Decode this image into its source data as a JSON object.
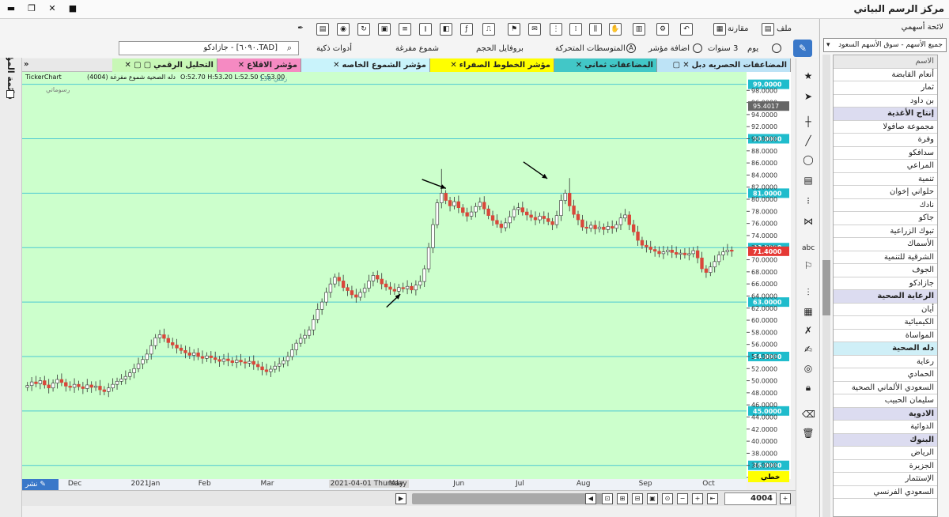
{
  "window": {
    "title": "مركز الرسم البياني"
  },
  "toolbar": {
    "file_label": "ملف",
    "compare_label": "مقارنة",
    "period_day": "يوم",
    "period_years": "3 سنوات",
    "add_indicator": "اضافة مؤشر",
    "moving_averages": "المتوسطات المتحركة",
    "volume_profile": "بروفايل الحجم",
    "hollow_candles": "شموع مفرغة",
    "smart_tools": "أدوات ذكية",
    "symbol_value": "[TAD.٦٠٩٠] - جازادكو"
  },
  "tabs": [
    {
      "label": "المضاعفات الحصريه دبل",
      "color": "#bde3f6"
    },
    {
      "label": "المضاعفات ثماني",
      "color": "#42c7c7"
    },
    {
      "label": "مؤشر الخطوط الصفراء",
      "color": "#ffff00"
    },
    {
      "label": "مؤشر الشموع الخاصه",
      "color": "#c9f3fb"
    },
    {
      "label": "مؤشر الاقلاع",
      "color": "#f58ac2"
    },
    {
      "label": "التحليل الرقمي",
      "color": "#c8f7b6"
    }
  ],
  "chart_header": {
    "source": "TickerChart",
    "description": "(4004) دله الصحية شموع مفرغة",
    "ohlc": "O:52.70  H:53.20  L:52.50  C:53.00",
    "watermark": "رسوماتي",
    "period_tag": "زمني 136"
  },
  "chart_data": {
    "type": "candlestick",
    "ylim": [
      34,
      100
    ],
    "y_ticks": [
      34,
      36,
      38,
      40,
      42,
      44,
      46,
      48,
      50,
      52,
      54,
      56,
      58,
      60,
      62,
      64,
      66,
      68,
      70,
      72,
      74,
      76,
      78,
      80,
      82,
      84,
      86,
      88,
      90,
      92,
      94,
      96,
      98
    ],
    "x_labels": [
      {
        "label": "Dec",
        "pos": 0.085
      },
      {
        "label": "2021Jan",
        "pos": 0.172
      },
      {
        "label": "Feb",
        "pos": 0.265
      },
      {
        "label": "Mar",
        "pos": 0.351
      },
      {
        "label": "2021-04-01 Thursday",
        "pos": 0.445
      },
      {
        "label": "May",
        "pos": 0.528
      },
      {
        "label": "Jun",
        "pos": 0.617
      },
      {
        "label": "Jul",
        "pos": 0.703
      },
      {
        "label": "Aug",
        "pos": 0.787
      },
      {
        "label": "Sep",
        "pos": 0.873
      },
      {
        "label": "Oct",
        "pos": 0.961
      }
    ],
    "horizontal_levels": [
      99,
      90,
      81,
      72,
      63,
      54,
      45,
      36
    ],
    "last_price": 71.4,
    "cursor_price": 95.4017,
    "bottom_label": "خطي",
    "closes": [
      49.2,
      49.8,
      49.5,
      50.0,
      49.3,
      48.8,
      49.6,
      50.2,
      49.7,
      49.1,
      48.9,
      49.4,
      49.0,
      48.7,
      49.3,
      48.9,
      49.1,
      48.5,
      48.2,
      48.8,
      49.4,
      49.9,
      50.3,
      50.7,
      51.3,
      52.0,
      52.8,
      53.5,
      54.4,
      55.8,
      57.1,
      57.6,
      57.0,
      56.3,
      55.9,
      55.4,
      55.0,
      54.6,
      54.2,
      54.6,
      54.0,
      53.7,
      54.1,
      53.8,
      53.5,
      53.2,
      53.6,
      53.3,
      53.0,
      53.4,
      53.1,
      52.9,
      53.2,
      52.7,
      52.3,
      51.8,
      51.5,
      51.9,
      52.4,
      52.8,
      53.3,
      54.0,
      55.1,
      56.2,
      57.0,
      57.5,
      58.4,
      60.1,
      61.8,
      63.0,
      64.6,
      66.0,
      67.1,
      66.5,
      65.4,
      64.9,
      64.2,
      63.8,
      64.6,
      65.3,
      66.5,
      67.4,
      66.8,
      66.0,
      65.5,
      65.1,
      64.8,
      65.4,
      65.2,
      65.6,
      65.0,
      65.8,
      66.4,
      68.5,
      72.0,
      75.8,
      79.4,
      81.0,
      79.8,
      78.9,
      79.6,
      78.6,
      77.8,
      77.2,
      77.9,
      78.8,
      79.5,
      78.4,
      77.3,
      76.5,
      75.9,
      75.3,
      76.1,
      77.1,
      78.3,
      78.6,
      77.9,
      77.4,
      77.0,
      76.6,
      77.2,
      76.8,
      76.3,
      75.8,
      77.3,
      79.8,
      81.0,
      78.9,
      77.5,
      76.6,
      75.4,
      75.2,
      75.7,
      75.1,
      75.4,
      75.0,
      75.5,
      75.2,
      75.8,
      76.9,
      77.4,
      75.8,
      74.6,
      73.2,
      72.4,
      72.1,
      71.7,
      71.4,
      71.0,
      71.3,
      71.6,
      71.2,
      70.9,
      71.1,
      70.8,
      71.0,
      71.5,
      70.3,
      68.5,
      67.9,
      68.8,
      69.7,
      70.8,
      71.3,
      71.6,
      71.4
    ],
    "spike_highs": [
      [
        97,
        85.0
      ],
      [
        127,
        83.5
      ],
      [
        98,
        81.5
      ]
    ],
    "annotations": [
      {
        "type": "arrow",
        "from": [
          0.552,
          0.264
        ],
        "to": [
          0.585,
          0.286
        ]
      },
      {
        "type": "arrow",
        "from": [
          0.692,
          0.221
        ],
        "to": [
          0.725,
          0.262
        ]
      },
      {
        "type": "arrow",
        "from": [
          0.503,
          0.578
        ],
        "to": [
          0.522,
          0.546
        ]
      }
    ]
  },
  "bottom_bar": {
    "zoom_value": "4004",
    "left_label": "نشر"
  },
  "left_panel": {
    "title": "قائمة المؤشرات"
  },
  "right_panel": {
    "title": "لائحة أسهمي",
    "filter": "جميع الأسهم - سوق الأسهم السعود",
    "header": "الاسم",
    "rows": [
      {
        "name": "أنعام القابضة",
        "kind": "stock"
      },
      {
        "name": "ثمار",
        "kind": "stock"
      },
      {
        "name": "بن داود",
        "kind": "stock"
      },
      {
        "name": "إنتاج الأغذية",
        "kind": "sector"
      },
      {
        "name": "مجموعة صافولا",
        "kind": "stock"
      },
      {
        "name": "وفرة",
        "kind": "stock"
      },
      {
        "name": "سدافكو",
        "kind": "stock"
      },
      {
        "name": "المراعي",
        "kind": "stock"
      },
      {
        "name": "تنمية",
        "kind": "stock"
      },
      {
        "name": "حلواني إخوان",
        "kind": "stock"
      },
      {
        "name": "نادك",
        "kind": "stock"
      },
      {
        "name": "جاكو",
        "kind": "stock"
      },
      {
        "name": "تبوك الزراعية",
        "kind": "stock"
      },
      {
        "name": "الأسماك",
        "kind": "stock"
      },
      {
        "name": "الشرقية للتنمية",
        "kind": "stock"
      },
      {
        "name": "الجوف",
        "kind": "stock"
      },
      {
        "name": "جازادكو",
        "kind": "stock"
      },
      {
        "name": "الرعاية الصحية",
        "kind": "sector"
      },
      {
        "name": "أيان",
        "kind": "stock"
      },
      {
        "name": "الكيميائية",
        "kind": "stock"
      },
      {
        "name": "المواساة",
        "kind": "stock"
      },
      {
        "name": "دله الصحية",
        "kind": "selected"
      },
      {
        "name": "رعاية",
        "kind": "stock"
      },
      {
        "name": "الحمادي",
        "kind": "stock"
      },
      {
        "name": "السعودي الألماني الصحية",
        "kind": "stock"
      },
      {
        "name": "سليمان الحبيب",
        "kind": "stock"
      },
      {
        "name": "الادوية",
        "kind": "sector"
      },
      {
        "name": "الدوائية",
        "kind": "stock"
      },
      {
        "name": "البنوك",
        "kind": "sector"
      },
      {
        "name": "الرياض",
        "kind": "stock"
      },
      {
        "name": "الجزيرة",
        "kind": "stock"
      },
      {
        "name": "الإستثمار",
        "kind": "stock"
      },
      {
        "name": "السعودي الفرنسي",
        "kind": "stock"
      }
    ]
  },
  "colors": {
    "chart_bg": "#ccffcc",
    "level_line": "#4cc9d2",
    "level_label_bg": "#1fbccc",
    "up_candle": "#ffffff",
    "down_candle": "#d9473a",
    "last_price_bg": "#e53935",
    "cursor_price_bg": "#666666"
  }
}
